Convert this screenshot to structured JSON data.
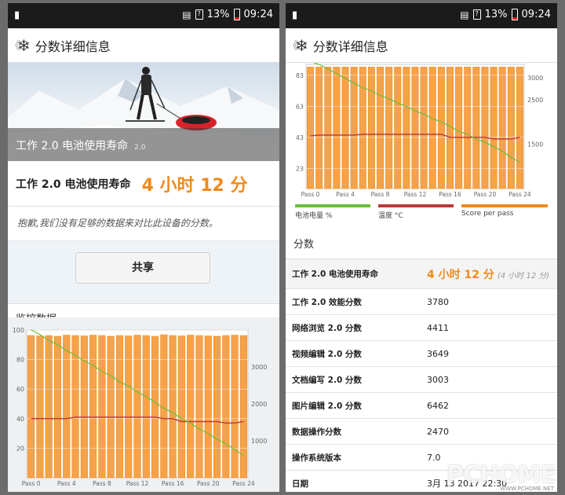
{
  "status": {
    "battery_pct": "13%",
    "time": "09:24"
  },
  "appbar": {
    "back": "《",
    "title": "分数详细信息"
  },
  "left": {
    "hero_caption": "工作 2.0 电池使用寿命",
    "hero_caption_version": "2.0",
    "score_label": "工作 2.0 电池使用寿命",
    "score_value": "4 小时 12 分",
    "notice": "抱歉,我们没有足够的数据来对比此设备的分数。",
    "share_label": "共享",
    "monitor_title": "监控数据"
  },
  "right": {
    "legend": [
      {
        "label": "电池电量 %",
        "color": "#6abf3a"
      },
      {
        "label": "温度 °C",
        "color": "#b83a3a"
      },
      {
        "label": "Score per pass",
        "color": "#f08a1c"
      }
    ],
    "scores_title": "分数",
    "rows": [
      {
        "k": "工作 2.0 电池使用寿命",
        "v": "4 小时 12 分",
        "sub": "(4 小时 12 分)"
      },
      {
        "k": "工作 2.0 效能分数",
        "v": "3780"
      },
      {
        "k": "网络浏览 2.0 分数",
        "v": "4411"
      },
      {
        "k": "视频编辑 2.0 分数",
        "v": "3649"
      },
      {
        "k": "文档编写 2.0 分数",
        "v": "3003"
      },
      {
        "k": "图片编辑 2.0 分数",
        "v": "6462"
      },
      {
        "k": "数据操作分数",
        "v": "2470"
      },
      {
        "k": "操作系统版本",
        "v": "7.0"
      },
      {
        "k": "日期",
        "v": "3月 13 2017 22:30"
      }
    ]
  },
  "watermark": {
    "brand": "PCHOME",
    "url": "WWW.PCHOME.NET"
  },
  "chart_data": [
    {
      "type": "bar",
      "panel": "left",
      "x_ticks": [
        "Pass 0",
        "Pass 4",
        "Pass 8",
        "Pass 12",
        "Pass 16",
        "Pass 20",
        "Pass 24"
      ],
      "left_ticks": [
        "100",
        "80",
        "60",
        "40",
        "20"
      ],
      "right_ticks": [
        "3000",
        "2000",
        "1000"
      ],
      "ylim_left": [
        0,
        100
      ],
      "ylim_right": [
        0,
        4000
      ],
      "bars": [
        3850,
        3840,
        3850,
        3830,
        3860,
        3850,
        3840,
        3860,
        3850,
        3830,
        3850,
        3840,
        3860,
        3850,
        3830,
        3870,
        3850,
        3840,
        3860,
        3850,
        3840,
        3830,
        3850,
        3860,
        3850
      ],
      "battery": [
        100,
        97,
        93,
        90,
        86,
        83,
        79,
        76,
        72,
        69,
        65,
        62,
        58,
        55,
        51,
        47,
        44,
        40,
        37,
        33,
        30,
        26,
        23,
        19,
        15
      ],
      "temperature": [
        40,
        40,
        40,
        40,
        40,
        41,
        41,
        41,
        41,
        41,
        41,
        41,
        41,
        41,
        41,
        40,
        40,
        38,
        38,
        38,
        38,
        38,
        37,
        37,
        38
      ]
    },
    {
      "type": "bar",
      "panel": "right",
      "x_ticks": [
        "Pass 0",
        "Pass 4",
        "Pass 8",
        "Pass 12",
        "Pass 16",
        "Pass 20",
        "Pass 24"
      ],
      "left_ticks": [
        "83",
        "63",
        "43",
        "23"
      ],
      "right_ticks": [
        "3000",
        "2500",
        "1500"
      ],
      "ylim_left": [
        10,
        90
      ],
      "ylim_right": [
        500,
        3300
      ],
      "bars": [
        3240,
        3240,
        3240,
        3240,
        3240,
        3240,
        3240,
        3240,
        3240,
        3240,
        3240,
        3240,
        3240,
        3240,
        3240,
        3240,
        3240,
        3240,
        3240,
        3240,
        3240,
        3240,
        3240,
        3240,
        3240
      ],
      "battery": [
        92,
        90,
        87,
        84,
        81,
        78,
        75,
        73,
        70,
        68,
        65,
        63,
        60,
        58,
        55,
        53,
        50,
        47,
        45,
        42,
        40,
        37,
        34,
        30,
        27
      ],
      "temperature": [
        44,
        44.5,
        44.5,
        44.5,
        44.5,
        44.5,
        45,
        45,
        45,
        45,
        45,
        45,
        45,
        45,
        45,
        45,
        43,
        43,
        43,
        43,
        43,
        42,
        42,
        42,
        43
      ]
    }
  ]
}
